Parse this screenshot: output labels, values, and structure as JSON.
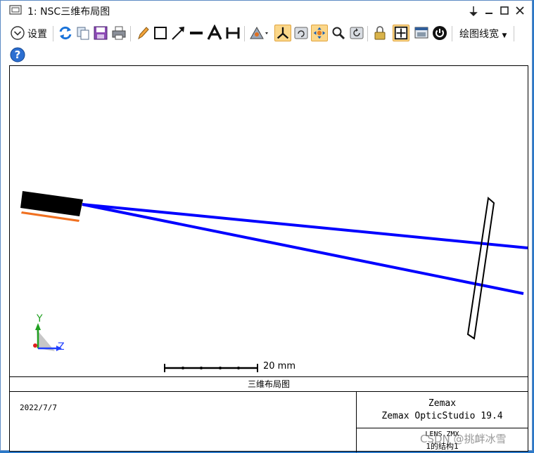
{
  "window": {
    "title": "1: NSC三维布局图",
    "controls": [
      "pin-icon",
      "minimize-icon",
      "maximize-icon",
      "close-icon"
    ]
  },
  "toolbar": {
    "settings_label": "设置",
    "linewidth_label": "绘图线宽",
    "icons": [
      "refresh-icon",
      "copy-icon",
      "save-icon",
      "print-icon",
      "pencil-icon",
      "rectangle-icon",
      "arrow-icon",
      "line-icon",
      "text-icon",
      "dimension-icon",
      "annotate-icon",
      "axes-icon",
      "rotate-icon",
      "pan-icon",
      "zoom-icon",
      "reset-view-icon",
      "lock-icon",
      "fit-icon",
      "window-icon",
      "power-icon"
    ],
    "help_icon": "help-icon"
  },
  "plot": {
    "scale_label": "20 mm",
    "axis_y": "Y",
    "axis_z": "Z",
    "ray_color": "#0000ff",
    "source_color": "#000000",
    "source_edge_color": "#f07020"
  },
  "footer": {
    "title": "三维布局图",
    "date": "2022/7/7",
    "brand_line1": "Zemax",
    "brand_line2": "Zemax OpticStudio 19.4",
    "file_name": "LENS.ZMX",
    "config": "1的结构1"
  },
  "watermark": "CSDN @挑衅冰雪"
}
